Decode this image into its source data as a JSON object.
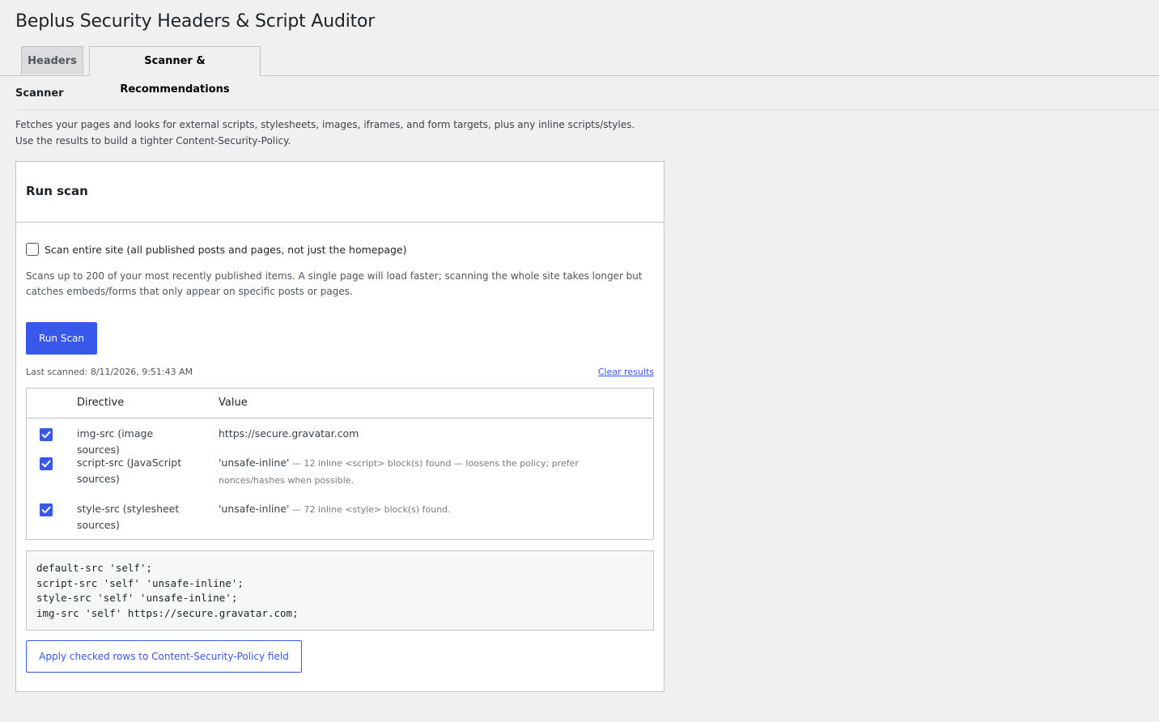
{
  "page": {
    "title": "Beplus Security Headers & Script Auditor"
  },
  "tabs": [
    {
      "label": "Headers",
      "active": false
    },
    {
      "label": "Scanner & Recommendations",
      "active": true
    }
  ],
  "scanner": {
    "title": "Scanner",
    "description": "Fetches your pages and looks for external scripts, stylesheets, images, iframes, and form targets, plus any inline scripts/styles. Use the results to build a tighter Content-Security-Policy."
  },
  "card": {
    "title": "Run scan",
    "scan_entire_site": {
      "label": "Scan entire site (all published posts and pages, not just the homepage)",
      "checked": false
    },
    "note": "Scans up to 200 of your most recently published items. A single page will load faster; scanning the whole site takes longer but catches embeds/forms that only appear on specific posts or pages.",
    "run_button": "Run Scan",
    "last_scanned": "Last scanned: 8/11/2026, 9:51:43 AM",
    "clear_results": "Clear results"
  },
  "table": {
    "headers": {
      "directive": "Directive",
      "value": "Value"
    },
    "rows": [
      {
        "checked": true,
        "directive": "img-src (image sources)",
        "value": "https://secure.gravatar.com",
        "note": ""
      },
      {
        "checked": true,
        "directive": "script-src (JavaScript sources)",
        "value": "'unsafe-inline'",
        "note": " — 12 inline <script> block(s) found — loosens the policy; prefer nonces/hashes when possible."
      },
      {
        "checked": true,
        "directive": "style-src (stylesheet sources)",
        "value": "'unsafe-inline'",
        "note": " — 72 inline <style> block(s) found."
      }
    ]
  },
  "policy_preview": "default-src 'self';\nscript-src 'self' 'unsafe-inline';\nstyle-src 'self' 'unsafe-inline';\nimg-src 'self' https://secure.gravatar.com;",
  "apply_button": "Apply checked rows to Content-Security-Policy field",
  "colors": {
    "accent": "#3858e9",
    "background": "#f0f0f1",
    "card": "#ffffff",
    "border": "#c3c4c7"
  },
  "icons": {
    "row_check": "checkmark-icon"
  }
}
